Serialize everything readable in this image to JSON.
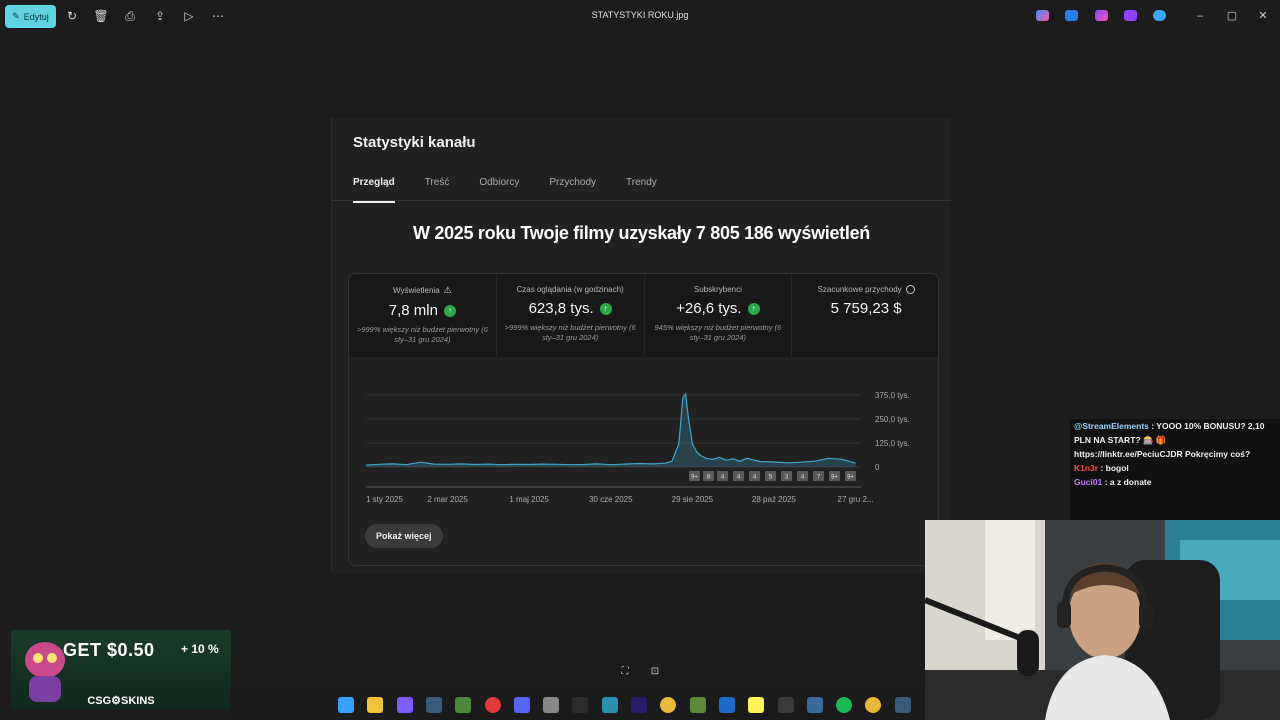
{
  "toolbar": {
    "edit_label": "Edytuj",
    "window_title": "STATYSTYKI ROKU.jpg",
    "icons": [
      "rotate-icon",
      "delete-icon",
      "print-icon",
      "share-icon",
      "slideshow-icon",
      "more-icon"
    ],
    "app_icons": [
      "copilot-icon",
      "designer-icon",
      "clipchamp-icon",
      "photos-icon",
      "onedrive-icon"
    ]
  },
  "analytics": {
    "title": "Statystyki kanału",
    "tabs": [
      "Przegląd",
      "Treść",
      "Odbiorcy",
      "Przychody",
      "Trendy"
    ],
    "headline": "W 2025 roku Twoje filmy uzyskały 7 805 186 wyświetleń",
    "metrics": [
      {
        "label": "Wyświetlenia",
        "value": "7,8 mln",
        "note": ">999% większy niż budżet pierwotny (6 sty–31 gru 2024)"
      },
      {
        "label": "Czas oglądania (w godzinach)",
        "value": "623,8 tys.",
        "note": ">999% większy niż budżet pierwotny (6 sty–31 gru 2024)"
      },
      {
        "label": "Subskrybenci",
        "value": "+26,6 tys.",
        "note": "945% większy niż budżet pierwotny (6 sty–31 gru 2024)"
      },
      {
        "label": "Szacunkowe przychody",
        "value": "5 759,23 $",
        "note": ""
      }
    ],
    "show_more": "Pokaż więcej"
  },
  "chart_data": {
    "type": "line",
    "title": "",
    "xlabel": "",
    "ylabel": "",
    "ylim": [
      0,
      400000
    ],
    "y_ticks": [
      "375,0 tys.",
      "250,0 tys.",
      "125,0 tys.",
      "0"
    ],
    "x_ticks": [
      "1 sty 2025",
      "2 mar 2025",
      "1 maj 2025",
      "30 cze 2025",
      "29 sie 2025",
      "28 paź 2025",
      "27 gru 2..."
    ],
    "x_tick_days": [
      0,
      60,
      120,
      180,
      240,
      300,
      360
    ],
    "series": [
      {
        "x": [
          0,
          10,
          20,
          30,
          40,
          50,
          60,
          70,
          80,
          90,
          100,
          110,
          120,
          130,
          140,
          150,
          160,
          170,
          180,
          190,
          200,
          210,
          220,
          225,
          230,
          233,
          235,
          237,
          240,
          243,
          246,
          250,
          255,
          260,
          265,
          270,
          275,
          280,
          290,
          300,
          310,
          320,
          330,
          340,
          350,
          360
        ],
        "y": [
          10000,
          14000,
          16000,
          12000,
          25000,
          15000,
          14000,
          16000,
          13000,
          15000,
          12000,
          14000,
          13000,
          15000,
          14000,
          12000,
          13000,
          16000,
          12000,
          15000,
          18000,
          16000,
          20000,
          30000,
          120000,
          360000,
          380000,
          260000,
          120000,
          80000,
          60000,
          45000,
          40000,
          50000,
          35000,
          42000,
          30000,
          45000,
          28000,
          26000,
          22000,
          25000,
          30000,
          45000,
          40000,
          20000
        ]
      }
    ],
    "markers": [
      "9+",
      "8",
      "4",
      "4",
      "4",
      "5",
      "3",
      "4",
      "7",
      "9+",
      "9+"
    ]
  },
  "chat": [
    {
      "user": "@StreamElements",
      "user_color": "#9ad6ff",
      "text": ": YOOO 10% BONUSU? 2,10 PLN NA START? 🎰 🎁 https://linktr.ee/PeciuCJDR Pokręcimy coś?"
    },
    {
      "user": "K1n3r",
      "user_color": "#ff4b4b",
      "text": ": bogol"
    },
    {
      "user": "Guci01",
      "user_color": "#c078ff",
      "text": ": a z donate"
    }
  ],
  "ad": {
    "title": "GET $0.50",
    "bonus": "+ 10 %",
    "brand": "CSG⚙SKINS"
  },
  "taskbar": {
    "icons": [
      "start-icon",
      "explorer-icon",
      "copilot-icon",
      "steam-icon",
      "app-icon",
      "opera-icon",
      "discord-icon",
      "settings-icon",
      "logitech-icon",
      "browser-icon",
      "premiere-icon",
      "chrome-icon",
      "minecraft-icon",
      "photoshop-icon",
      "snapchat-icon",
      "dots-icon",
      "app2-icon",
      "spotify-icon",
      "chrome2-icon",
      "steam2-icon"
    ]
  }
}
